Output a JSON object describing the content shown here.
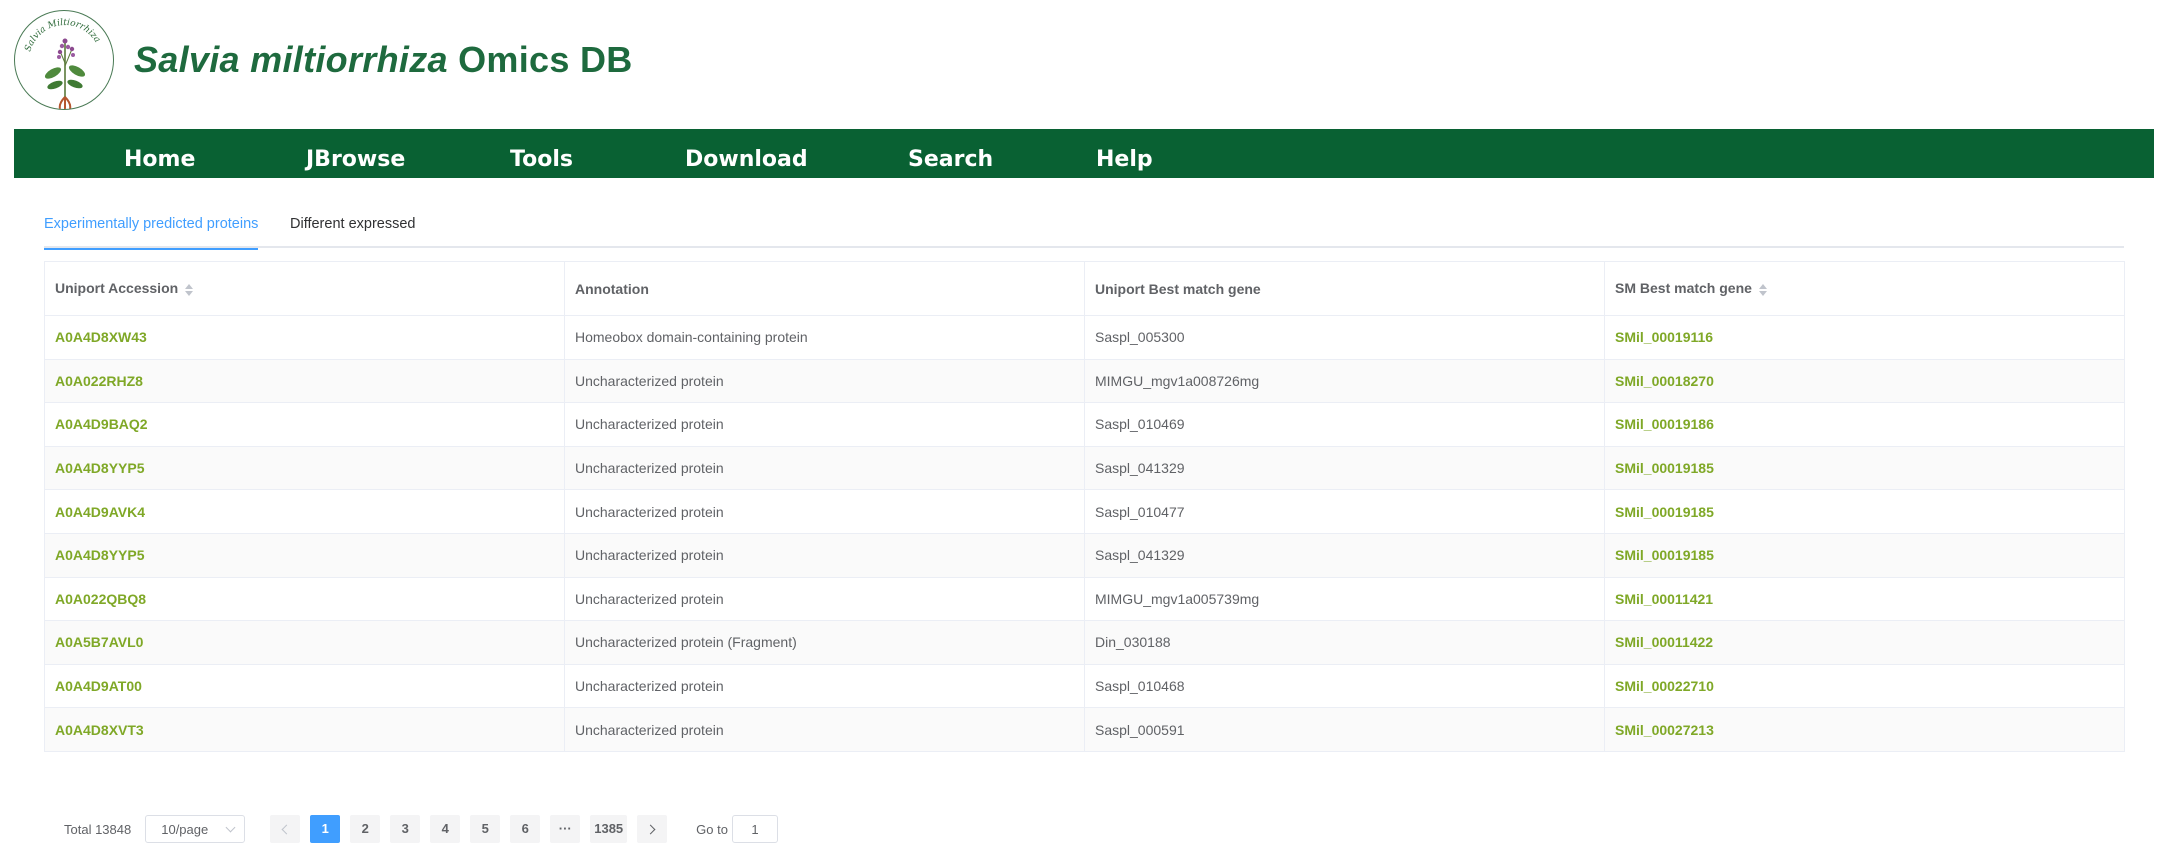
{
  "header": {
    "title_italic": "Salvia miltiorrhiza",
    "title_rest": " Omics DB",
    "logo_text": "Salvia Miltiorrhiza"
  },
  "nav": {
    "items": [
      {
        "label": "Home"
      },
      {
        "label": "JBrowse"
      },
      {
        "label": "Tools"
      },
      {
        "label": "Download"
      },
      {
        "label": "Search"
      },
      {
        "label": "Help"
      }
    ]
  },
  "tabs": [
    {
      "label": "Experimentally predicted proteins",
      "active": true
    },
    {
      "label": "Different expressed",
      "active": false
    }
  ],
  "table": {
    "columns": [
      {
        "label": "Uniport Accession",
        "sortable": true
      },
      {
        "label": "Annotation",
        "sortable": false
      },
      {
        "label": "Uniport Best match gene",
        "sortable": false
      },
      {
        "label": "SM Best match gene",
        "sortable": true
      }
    ],
    "rows": [
      [
        "A0A4D8XW43",
        "Homeobox domain-containing protein",
        "Saspl_005300",
        "SMil_00019116"
      ],
      [
        "A0A022RHZ8",
        "Uncharacterized protein",
        "MIMGU_mgv1a008726mg",
        "SMil_00018270"
      ],
      [
        "A0A4D9BAQ2",
        "Uncharacterized protein",
        "Saspl_010469",
        "SMil_00019186"
      ],
      [
        "A0A4D8YYP5",
        "Uncharacterized protein",
        "Saspl_041329",
        "SMil_00019185"
      ],
      [
        "A0A4D9AVK4",
        "Uncharacterized protein",
        "Saspl_010477",
        "SMil_00019185"
      ],
      [
        "A0A4D8YYP5",
        "Uncharacterized protein",
        "Saspl_041329",
        "SMil_00019185"
      ],
      [
        "A0A022QBQ8",
        "Uncharacterized protein",
        "MIMGU_mgv1a005739mg",
        "SMil_00011421"
      ],
      [
        "A0A5B7AVL0",
        "Uncharacterized protein (Fragment)",
        "Din_030188",
        "SMil_00011422"
      ],
      [
        "A0A4D9AT00",
        "Uncharacterized protein",
        "Saspl_010468",
        "SMil_00022710"
      ],
      [
        "A0A4D8XVT3",
        "Uncharacterized protein",
        "Saspl_000591",
        "SMil_00027213"
      ]
    ]
  },
  "pagination": {
    "total_label": "Total 13848",
    "page_size": "10/page",
    "pages": [
      "1",
      "2",
      "3",
      "4",
      "5",
      "6"
    ],
    "ellipsis": "···",
    "last_page": "1385",
    "current_page": "1",
    "goto_label": "Go to",
    "goto_value": "1"
  },
  "colors": {
    "brand_green": "#096133",
    "title_green": "#1e6a3e",
    "link_green": "#7fa827",
    "accent_blue": "#409eff"
  }
}
